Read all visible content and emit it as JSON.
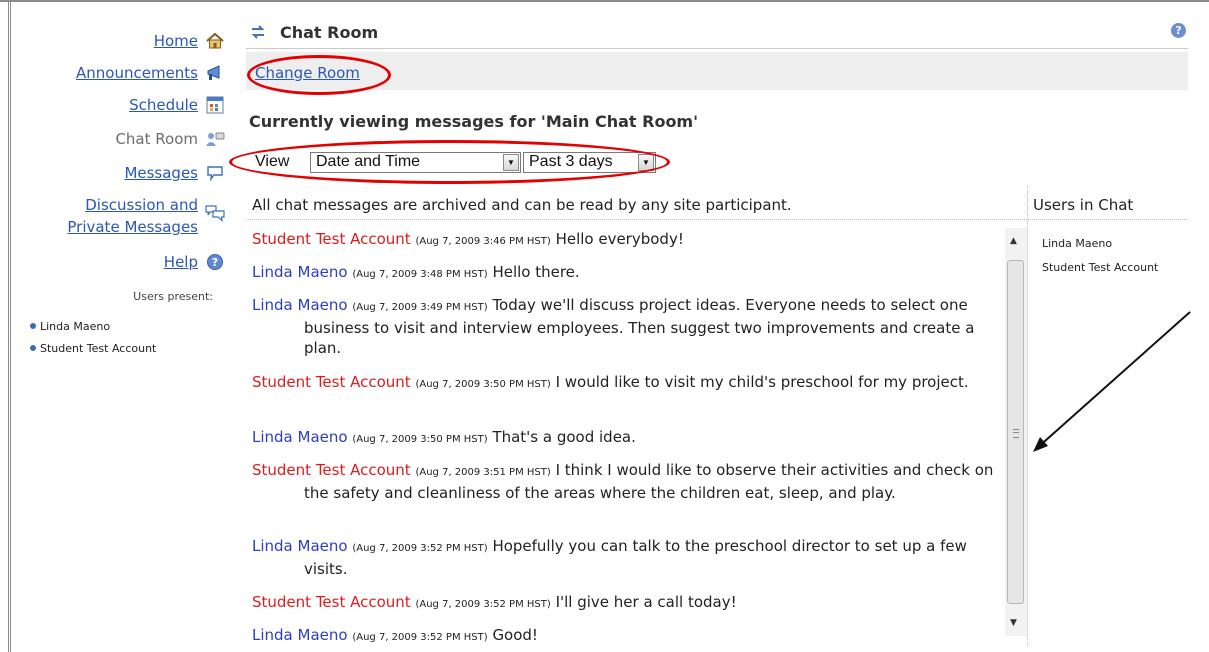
{
  "nav": {
    "items": [
      {
        "label": "Home",
        "icon": "home-icon",
        "current": false
      },
      {
        "label": "Announcements",
        "icon": "megaphone-icon",
        "current": false
      },
      {
        "label": "Schedule",
        "icon": "calendar-icon",
        "current": false
      },
      {
        "label": "Chat Room",
        "icon": "chat-room-icon",
        "current": true
      },
      {
        "label": "Messages",
        "icon": "speech-bubble-icon",
        "current": false
      },
      {
        "label_line1": "Discussion and",
        "label_line2": "Private Messages",
        "icon": "discussion-icon",
        "current": false
      },
      {
        "label": "Help",
        "icon": "help-icon",
        "current": false
      }
    ],
    "users_present_label": "Users present:",
    "users_present": [
      "Linda Maeno",
      "Student Test Account"
    ]
  },
  "header": {
    "title": "Chat Room",
    "help_icon": "help-icon"
  },
  "toolbar": {
    "change_room": "Change Room"
  },
  "viewing": "Currently viewing messages for 'Main Chat Room'",
  "view": {
    "label": "View",
    "sort_value": "Date and Time",
    "range_value": "Past 3 days"
  },
  "notice": "All chat messages are archived and can be read by any site participant.",
  "users_in_chat": {
    "title": "Users in Chat",
    "users": [
      "Linda Maeno",
      "Student Test Account"
    ]
  },
  "messages": [
    {
      "author": "Student Test Account",
      "time": "(Aug 7, 2009 3:46 PM HST)",
      "text": "Hello everybody!"
    },
    {
      "author": "Linda Maeno",
      "time": "(Aug 7, 2009 3:48 PM HST)",
      "text": "Hello there."
    },
    {
      "author": "Linda Maeno",
      "time": "(Aug 7, 2009 3:49 PM HST)",
      "text": "Today we'll discuss project ideas. Everyone needs to select one business to visit and interview employees. Then suggest two improvements and create a plan."
    },
    {
      "author": "Student Test Account",
      "time": "(Aug 7, 2009 3:50 PM HST)",
      "text": "I would like to visit my child's preschool for my project."
    },
    {
      "author": "Linda Maeno",
      "time": "(Aug 7, 2009 3:50 PM HST)",
      "text": "That's a good idea."
    },
    {
      "author": "Student Test Account",
      "time": "(Aug 7, 2009 3:51 PM HST)",
      "text": "I think I would like to observe their activities and check on the safety and cleanliness of the areas where the children eat, sleep, and play."
    },
    {
      "author": "Linda Maeno",
      "time": "(Aug 7, 2009 3:52 PM HST)",
      "text": "Hopefully you can talk to the preschool director to set up a few visits."
    },
    {
      "author": "Student Test Account",
      "time": "(Aug 7, 2009 3:52 PM HST)",
      "text": "I'll give her a call today!"
    },
    {
      "author": "Linda Maeno",
      "time": "(Aug 7, 2009 3:52 PM HST)",
      "text": "Good!"
    }
  ],
  "colors": {
    "student": "#e01b1b",
    "instructor": "#2d3ec2",
    "link": "#2a57b8",
    "annotation": "#e30000"
  }
}
